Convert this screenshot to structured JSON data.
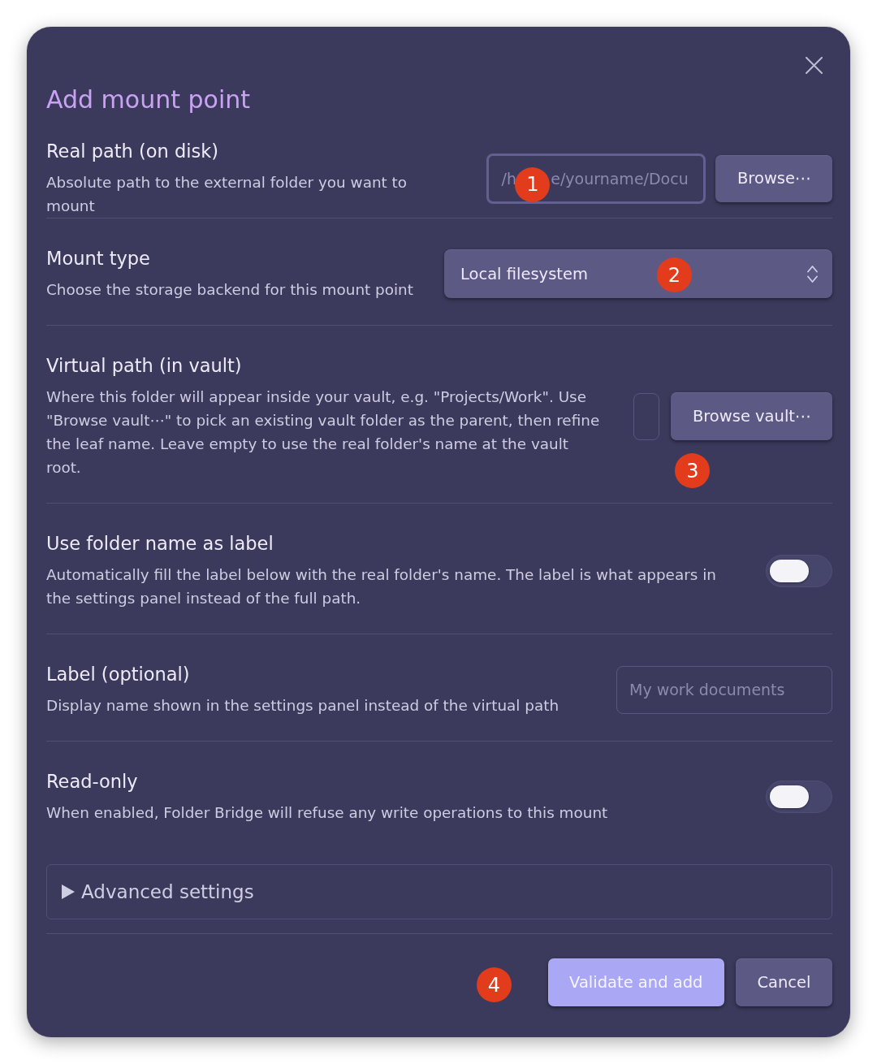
{
  "dialog": {
    "title": "Add mount point"
  },
  "settings": [
    {
      "kind": "path",
      "name": "Real path (on disk)",
      "description": "Absolute path to the external folder you want to mount",
      "field": {
        "placeholder": "/h       e/yourname/Docu",
        "focused": true
      },
      "button": "Browse⋯",
      "marker": "1"
    },
    {
      "kind": "dropdown",
      "name": "Mount type",
      "description": "Choose the storage backend for this mount point",
      "value": "Local filesystem",
      "marker": "2"
    },
    {
      "kind": "vaultpath",
      "name": "Virtual path (in vault)",
      "description": "Where this folder will appear inside your vault, e.g. \"Projects/Work\". Use \"Browse vault⋯\" to pick an existing vault folder as the parent, then refine the leaf name. Leave empty to use the real folder's name at the vault root.",
      "field": {
        "focused": false
      },
      "button": "Browse vault⋯",
      "marker": "3"
    },
    {
      "kind": "toggle",
      "name": "Use folder name as label",
      "description": "Automatically fill the label below with the real folder's name. The label is what appears in the settings panel instead of the full path.",
      "on": false
    },
    {
      "kind": "text",
      "name": "Label (optional)",
      "description": "Display name shown in the settings panel instead of the virtual path",
      "field": {
        "placeholder": "My work documents",
        "focused": false
      }
    },
    {
      "kind": "toggle",
      "name": "Read-only",
      "description": "When enabled, Folder Bridge will refuse any write operations to this mount",
      "on": false
    }
  ],
  "advanced": {
    "label": "Advanced settings",
    "expanded": false
  },
  "footer": {
    "marker": "4",
    "buttons": [
      {
        "label": "Validate and add",
        "kind": "primary"
      },
      {
        "label": "Cancel",
        "kind": "secondary"
      }
    ]
  }
}
